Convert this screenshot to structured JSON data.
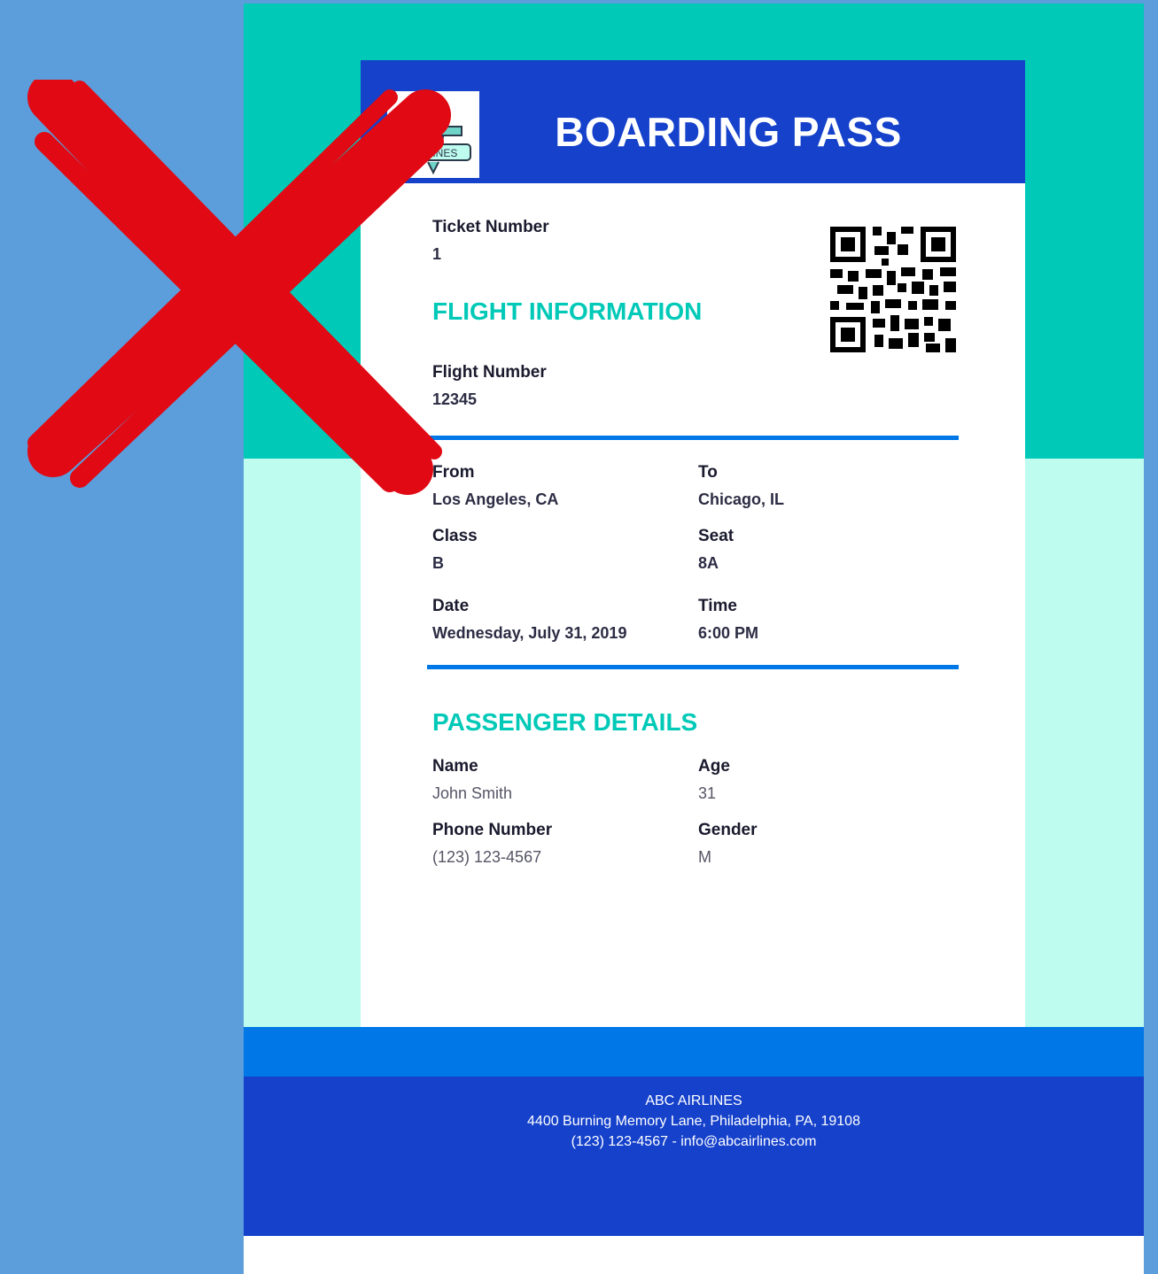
{
  "header": {
    "title": "BOARDING PASS",
    "logo_text": "AIRLINES"
  },
  "ticket": {
    "label": "Ticket Number",
    "value": "1"
  },
  "flight_section": {
    "title": "FLIGHT INFORMATION"
  },
  "flight_number": {
    "label": "Flight Number",
    "value": "12345"
  },
  "from": {
    "label": "From",
    "value": "Los Angeles, CA"
  },
  "to": {
    "label": "To",
    "value": "Chicago, IL"
  },
  "class": {
    "label": "Class",
    "value": "B"
  },
  "seat": {
    "label": "Seat",
    "value": "8A"
  },
  "date": {
    "label": "Date",
    "value": "Wednesday, July 31, 2019"
  },
  "time": {
    "label": "Time",
    "value": "6:00 PM"
  },
  "passenger_section": {
    "title": "PASSENGER DETAILS"
  },
  "name": {
    "label": "Name",
    "value": "John Smith"
  },
  "age": {
    "label": "Age",
    "value": "31"
  },
  "phone": {
    "label": "Phone Number",
    "value": "(123) 123-4567"
  },
  "gender": {
    "label": "Gender",
    "value": "M"
  },
  "footer": {
    "company": "ABC AIRLINES",
    "address": "4400 Burning Memory Lane, Philadelphia, PA, 19108",
    "contact": "(123) 123-4567 - info@abcairlines.com"
  },
  "colors": {
    "background": "#5c9edb",
    "teal": "#00c9b7",
    "mint": "#bdfcef",
    "royal_blue": "#1541cb",
    "bright_blue": "#0077e6",
    "cross_red": "#e00914"
  },
  "icons": [
    "airline-logo-icon",
    "qr-code-icon",
    "red-x-mark-icon"
  ]
}
